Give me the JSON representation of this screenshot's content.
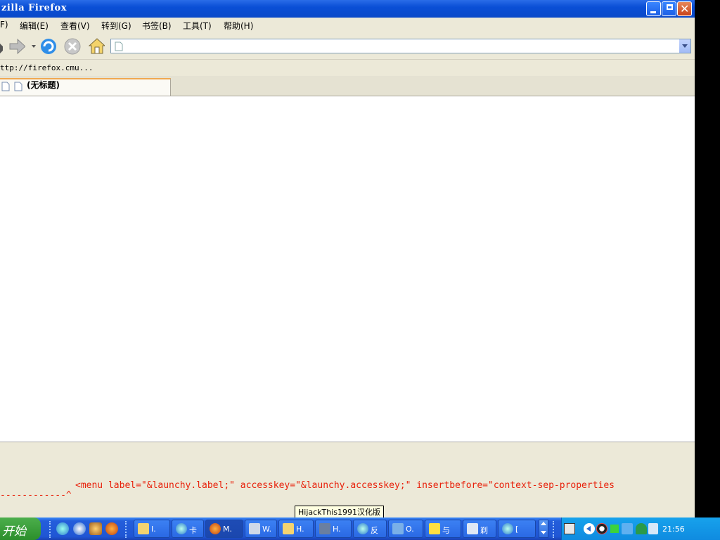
{
  "window": {
    "title": "zilla Firefox"
  },
  "menu": [
    "F)",
    "编辑(E)",
    "查看(V)",
    "转到(G)",
    "书签(B)",
    "工具(T)",
    "帮助(H)"
  ],
  "bookmarks": {
    "item": "ttp://firefox.cmu..."
  },
  "tab": {
    "title": "(无标题)"
  },
  "url": {
    "value": ""
  },
  "console": {
    "code": "<menu label=\"&launchy.label;\" accesskey=\"&launchy.accesskey;\" insertbefore=\"context-sep-properties",
    "dashes": "------------^"
  },
  "tooltip": "HijackThis1991汉化版",
  "taskbar": {
    "start": "开始",
    "tasks": [
      {
        "label": "I.",
        "icon": "folder-icon"
      },
      {
        "label": "卡",
        "icon": "ie-icon"
      },
      {
        "label": "M.",
        "icon": "firefox-icon"
      },
      {
        "label": "W.",
        "icon": "computer-icon"
      },
      {
        "label": "H.",
        "icon": "folder-icon"
      },
      {
        "label": "H.",
        "icon": "hijackthis-icon"
      },
      {
        "label": "反",
        "icon": "ie-icon"
      },
      {
        "label": "O.",
        "icon": "outlook-icon"
      },
      {
        "label": "与",
        "icon": "note-icon"
      },
      {
        "label": "剃",
        "icon": "app-icon"
      },
      {
        "label": "[",
        "icon": "ie-icon"
      }
    ],
    "clock": "21:56"
  }
}
